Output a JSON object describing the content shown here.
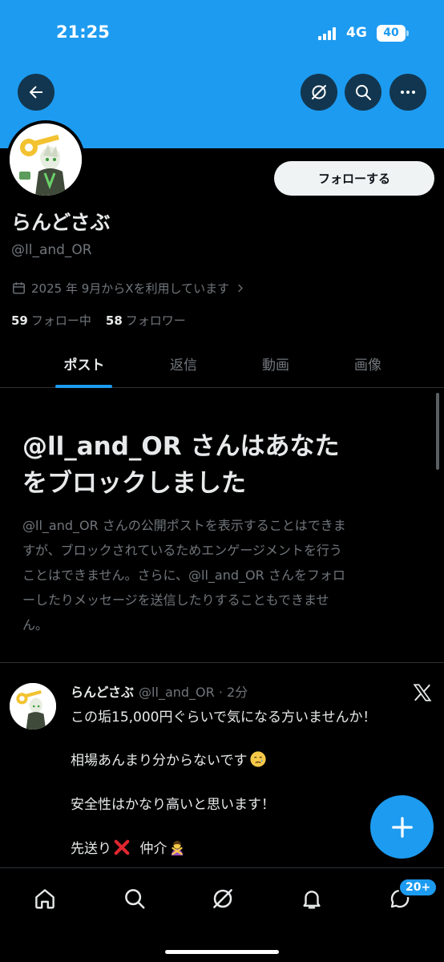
{
  "status_bar": {
    "time": "21:25",
    "network": "4G",
    "battery": "40"
  },
  "header": {
    "back_icon": "arrow-left-icon",
    "grok_icon": "grok-icon",
    "search_icon": "search-icon",
    "more_icon": "more-horizontal-icon"
  },
  "profile": {
    "display_name": "らんどさぶ",
    "handle": "@ll_and_OR",
    "joined": "2025 年 9月からXを利用しています",
    "following_count": "59",
    "following_label": "フォロー中",
    "followers_count": "58",
    "followers_label": "フォロワー",
    "follow_button": "フォローする"
  },
  "tabs": [
    {
      "label": "ポスト",
      "active": true
    },
    {
      "label": "返信",
      "active": false
    },
    {
      "label": "動画",
      "active": false
    },
    {
      "label": "画像",
      "active": false
    }
  ],
  "blocked": {
    "title_line1": "@ll_and_OR さんはあなた",
    "title_line2": "をブロックしました",
    "desc_lines": [
      "@ll_and_OR さんの公開ポストを表示することはできま",
      "すが、ブロックされているためエンゲージメントを行う",
      "ことはできません。さらに、@ll_and_OR さんをフォロ",
      "ーしたりメッセージを送信したりすることもできませ",
      "ん。"
    ]
  },
  "post": {
    "author": "らんどさぶ",
    "meta": "@ll_and_OR · 2分",
    "lines": [
      "この垢15,000円ぐらいで気になる方いませんか！",
      "相場あんまり分からないです",
      "安全性はかなり高いと思います！",
      "先送り",
      "仲介"
    ]
  },
  "bottom_nav": {
    "items": [
      "home-icon",
      "search-icon",
      "grok-icon",
      "notifications-icon",
      "messages-icon"
    ],
    "badge": "20+"
  },
  "colors": {
    "accent": "#1d9bf0",
    "background": "#000000",
    "muted": "#71767b"
  }
}
